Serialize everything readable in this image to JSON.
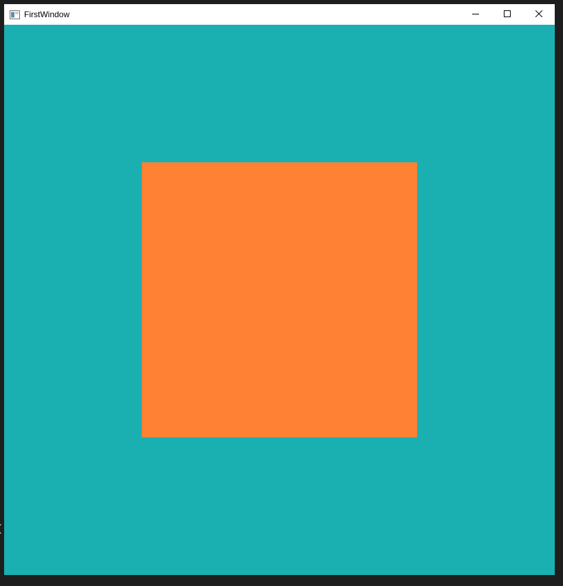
{
  "window": {
    "title": "FirstWindow",
    "icon": "app-window-icon",
    "controls": {
      "minimize": "minimize-icon",
      "maximize": "maximize-icon",
      "close": "close-icon"
    }
  },
  "canvas": {
    "background_color": "#1ab0b1",
    "square_color": "#ff8133"
  },
  "desktop": {
    "edge_glyph": "("
  }
}
